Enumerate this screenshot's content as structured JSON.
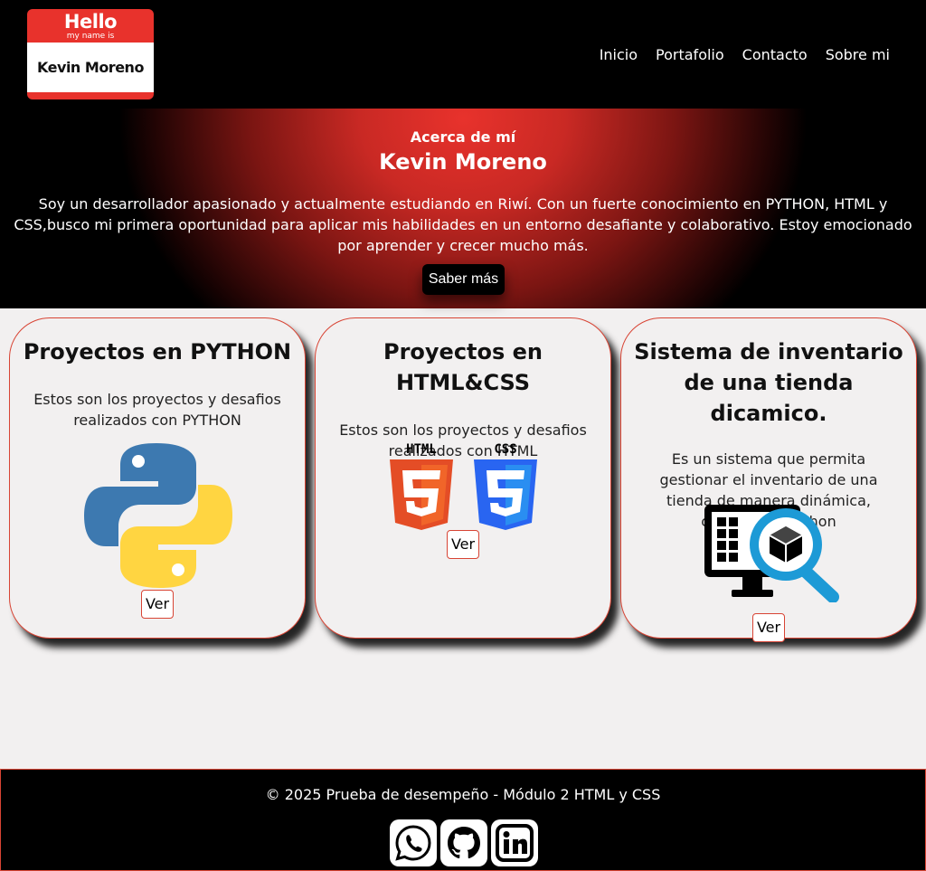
{
  "logo": {
    "hello": "Hello",
    "my_name_is": "my name is",
    "name": "Kevin Moreno"
  },
  "nav": [
    "Inicio",
    "Portafolio",
    "Contacto",
    "Sobre mi"
  ],
  "hero": {
    "kicker": "Acerca de mí",
    "name": "Kevin Moreno",
    "bio": "Soy un desarrollador apasionado y actualmente estudiando en Riwí. Con un fuerte conocimiento en PYTHON, HTML y CSS,busco mi primera oportunidad para aplicar mis habilidades en un entorno desafiante y colaborativo. Estoy emocionado por aprender y crecer mucho más.",
    "button": "Saber más"
  },
  "cards": [
    {
      "title": "Proyectos en PYTHON",
      "desc": "Estos son los proyectos y desafios realizados con PYTHON",
      "button": "Ver",
      "icon": "python-logo-icon"
    },
    {
      "title": "Proyectos en HTML&CSS",
      "desc": "Estos son los proyectos y desafios realizados con HTML",
      "button": "Ver",
      "icon": "html5-css3-icon",
      "badges": [
        "HTML",
        "CSS"
      ]
    },
    {
      "title": "Sistema de inventario de una tienda dicamico.",
      "desc": "Es un sistema que permita gestionar el inventario de una tienda de manera dinámica, creado con python",
      "button": "Ver",
      "icon": "inventory-search-icon"
    }
  ],
  "footer": {
    "copyright": "© 2025 Prueba de desempeño - Módulo 2 HTML y CSS",
    "social": [
      "whatsapp-icon",
      "github-icon",
      "linkedin-icon"
    ]
  },
  "colors": {
    "accent": "#d84434",
    "hero_red": "#e8322c",
    "background": "#f2f0f0",
    "python_blue": "#3d79b0",
    "python_yellow": "#ffd541",
    "html_orange": "#e44d26",
    "css_blue": "#2965f1",
    "inventory_blue": "#1d9ad6"
  }
}
